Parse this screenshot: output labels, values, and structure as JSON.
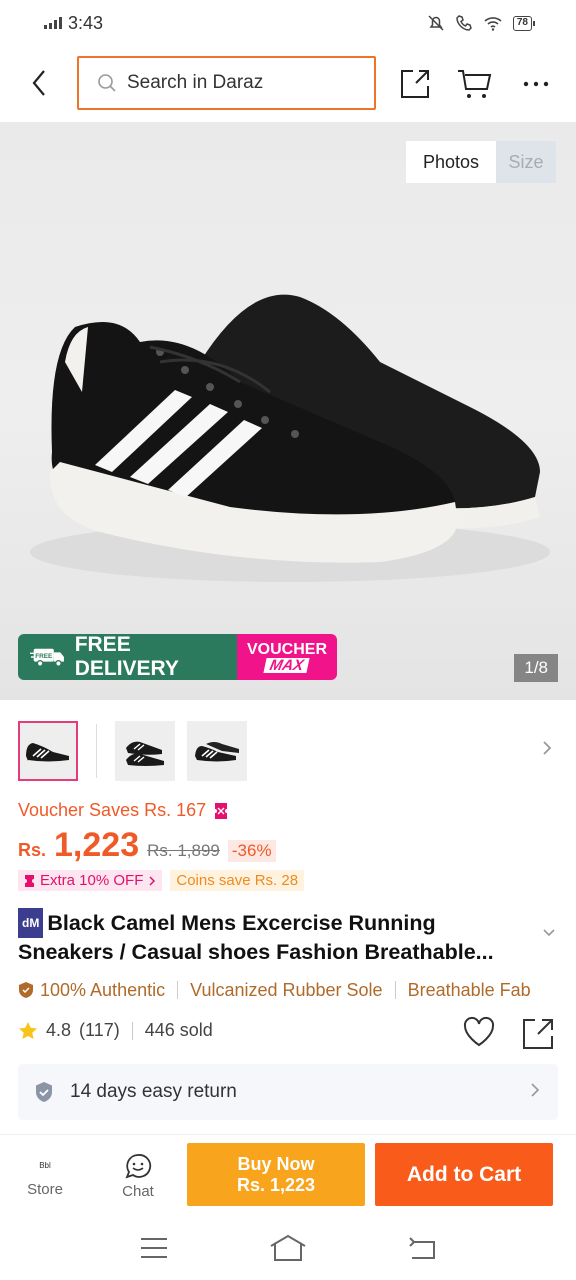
{
  "status_bar": {
    "time": "3:43",
    "battery": "78"
  },
  "search": {
    "placeholder": "Search in Daraz"
  },
  "gallery": {
    "tabs": [
      "Photos",
      "Size"
    ],
    "counter": "1/8",
    "promo_free_delivery": "FREE DELIVERY",
    "promo_free_badge": "FREE",
    "promo_voucher_line1": "VOUCHER",
    "promo_voucher_line2": "MAX"
  },
  "price": {
    "voucher_saves": "Voucher Saves Rs. 167",
    "currency": "Rs.",
    "current": "1,223",
    "original": "Rs. 1,899",
    "discount": "-36%",
    "extra_off": "Extra 10% OFF",
    "coins_save": "Coins save Rs. 28"
  },
  "product": {
    "badge": "dM",
    "title": "Black Camel Mens Excercise Running Sneakers / Casual shoes Fashion Breathable..."
  },
  "attributes": [
    "100% Authentic",
    "Vulcanized Rubber Sole",
    "Breathable Fab"
  ],
  "rating": {
    "score": "4.8",
    "count": "(117)",
    "sold": "446 sold"
  },
  "return_policy": {
    "label": "14 days easy return"
  },
  "bottom_bar": {
    "store_logo": "Bbl",
    "store_label": "Store",
    "chat_label": "Chat",
    "buy_now_line1": "Buy Now",
    "buy_now_line2": "Rs. 1,223",
    "add_to_cart": "Add to Cart"
  },
  "colors": {
    "accent_orange": "#f85b1a",
    "buy_now": "#f8a41c",
    "price": "#f05a28",
    "promo_green": "#2c7a5d",
    "promo_pink": "#f0138a"
  }
}
